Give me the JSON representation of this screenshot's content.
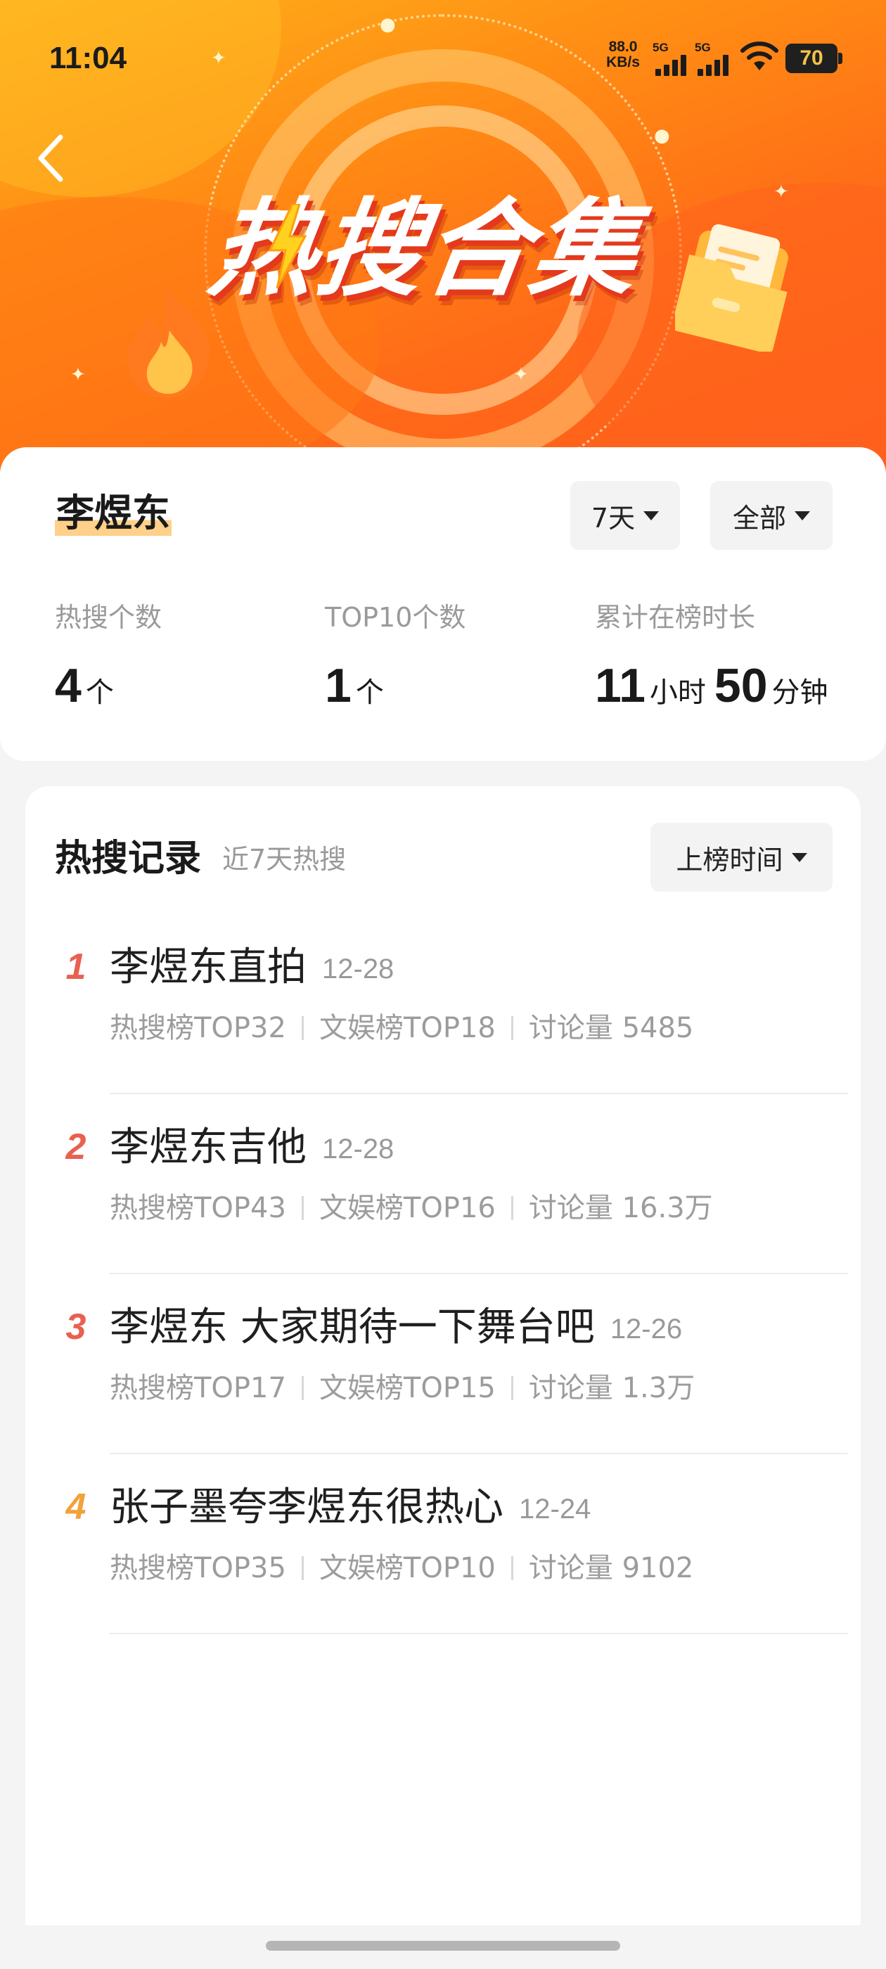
{
  "status_bar": {
    "time": "11:04",
    "net_speed_value": "88.0",
    "net_speed_unit": "KB/s",
    "signal_1_tag": "5G",
    "signal_2_tag": "5G",
    "battery": "70"
  },
  "header": {
    "title": "热搜合集"
  },
  "summary": {
    "name": "李煜东",
    "range_filter": "7天",
    "type_filter": "全部",
    "stats": {
      "count_label": "热搜个数",
      "count_value": "4",
      "count_unit": "个",
      "top10_label": "TOP10个数",
      "top10_value": "1",
      "top10_unit": "个",
      "duration_label": "累计在榜时长",
      "duration_hours": "11",
      "duration_hours_unit": "小时",
      "duration_minutes": "50",
      "duration_minutes_unit": "分钟"
    }
  },
  "records": {
    "title": "热搜记录",
    "subtitle": "近7天热搜",
    "sort_filter": "上榜时间",
    "items": [
      {
        "rank": "1",
        "rank_color": "#e8614f",
        "title": "李煜东直拍",
        "date": "12-28",
        "hot_rank": "热搜榜TOP32",
        "ent_rank": "文娱榜TOP18",
        "discussion": "讨论量 5485"
      },
      {
        "rank": "2",
        "rank_color": "#e8614f",
        "title": "李煜东吉他",
        "date": "12-28",
        "hot_rank": "热搜榜TOP43",
        "ent_rank": "文娱榜TOP16",
        "discussion": "讨论量 16.3万"
      },
      {
        "rank": "3",
        "rank_color": "#e8614f",
        "title": "李煜东 大家期待一下舞台吧",
        "date": "12-26",
        "hot_rank": "热搜榜TOP17",
        "ent_rank": "文娱榜TOP15",
        "discussion": "讨论量 1.3万"
      },
      {
        "rank": "4",
        "rank_color": "#f2a23a",
        "title": "张子墨夸李煜东很热心",
        "date": "12-24",
        "hot_rank": "热搜榜TOP35",
        "ent_rank": "文娱榜TOP10",
        "discussion": "讨论量 9102"
      }
    ]
  },
  "colors": {
    "banner_start": "#ffb21a",
    "banner_end": "#ff5a1c",
    "name_highlight": "#ffd08a",
    "rank_red": "#e8614f",
    "rank_orange": "#f2a23a"
  },
  "icons": {
    "back": "chevron-left-icon",
    "wifi": "wifi-icon",
    "battery": "battery-icon",
    "flame": "flame-icon",
    "folder": "folder-icon",
    "bolt": "lightning-bolt-icon",
    "caret": "caret-down-icon"
  }
}
